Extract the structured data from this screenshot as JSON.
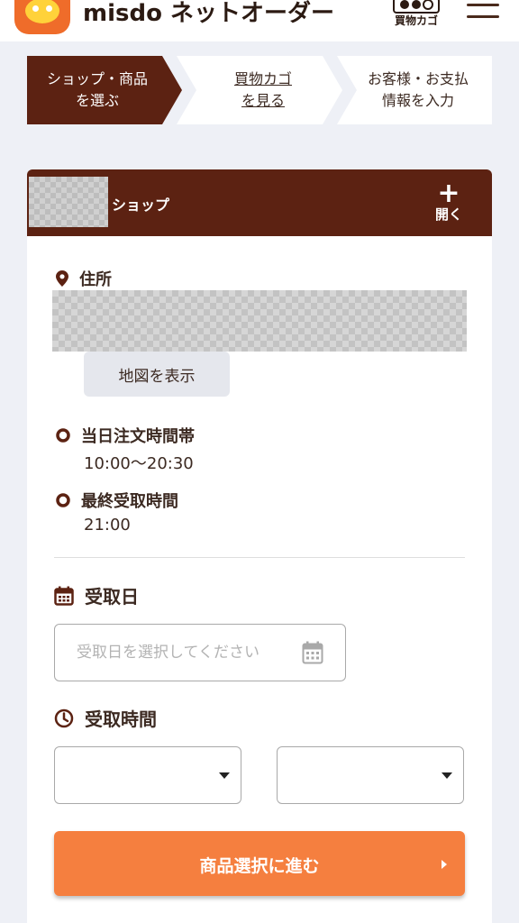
{
  "header": {
    "brand": "misdo",
    "service_name": "ネットオーダー",
    "cart_label": "買物カゴ",
    "menu_icon": "hamburger-icon"
  },
  "stepper": {
    "steps": [
      {
        "line1": "ショップ・商品",
        "line2": "を選ぶ",
        "active": true
      },
      {
        "line1": "買物カゴ",
        "line2": "を見る",
        "active": false
      },
      {
        "line1": "お客様・お支払",
        "line2": "情報を入力",
        "active": false
      }
    ]
  },
  "shop": {
    "label": "ショップ",
    "open_icon": "+",
    "open_label": "開く",
    "address_label": "住所",
    "map_button": "地図を表示",
    "sameday_label": "当日注文時間帯",
    "sameday_value": "10:00〜20:30",
    "last_label": "最終受取時間",
    "last_value": "21:00"
  },
  "pickup": {
    "date_label": "受取日",
    "date_placeholder": "受取日を選択してください",
    "time_label": "受取時間",
    "time_start_value": "",
    "time_end_value": ""
  },
  "cta": {
    "label": "商品選択に進む"
  },
  "colors": {
    "brand_brown": "#5c2212",
    "accent_orange": "#f57f3f",
    "background": "#eef0f6"
  }
}
